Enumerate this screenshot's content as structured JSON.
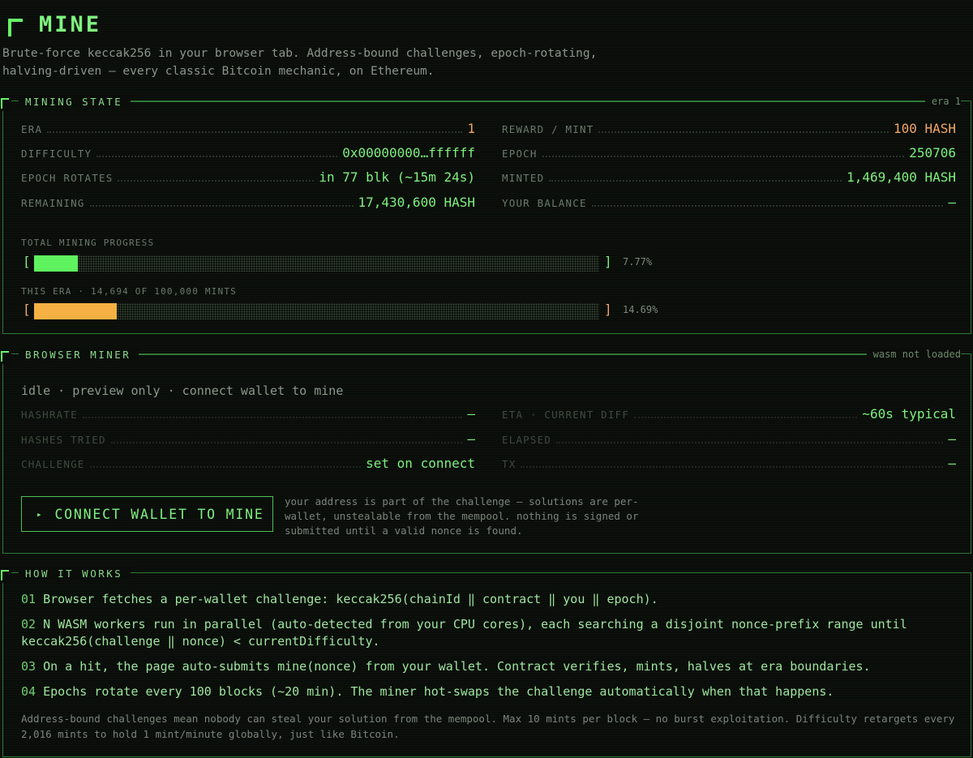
{
  "header": {
    "title": "MINE",
    "subtitle": "Brute-force keccak256 in your browser tab. Address-bound challenges, epoch-rotating, halving-driven — every classic Bitcoin mechanic, on Ethereum."
  },
  "mining_state": {
    "title": "MINING STATE",
    "tag": "era 1",
    "left": [
      {
        "label": "ERA",
        "value": "1"
      },
      {
        "label": "DIFFICULTY",
        "value": "0x00000000…ffffff"
      },
      {
        "label": "EPOCH ROTATES",
        "value": "in 77 blk (~15m 24s)"
      },
      {
        "label": "REMAINING",
        "value": "17,430,600 HASH"
      }
    ],
    "right": [
      {
        "label": "REWARD / MINT",
        "value": "100 HASH"
      },
      {
        "label": "EPOCH",
        "value": "250706"
      },
      {
        "label": "MINTED",
        "value": "1,469,400 HASH"
      },
      {
        "label": "YOUR BALANCE",
        "value": "—"
      }
    ],
    "total_progress": {
      "label": "TOTAL MINING PROGRESS",
      "percent_text": "7.77%",
      "fraction": 0.0777,
      "bracket_open": "[",
      "bracket_close": "]"
    },
    "era_progress": {
      "label": "THIS ERA · 14,694 OF 100,000 MINTS",
      "percent_text": "14.69%",
      "fraction": 0.1469,
      "bracket_open": "[",
      "bracket_close": "]"
    },
    "colors": {
      "accent": "#7ef07e",
      "orange": "#f1a668",
      "total_bar": "#5ef25e",
      "era_bar": "#f4b043"
    }
  },
  "browser_miner": {
    "title": "BROWSER MINER",
    "tag": "wasm not loaded",
    "status": "idle · preview only · connect wallet to mine",
    "left": [
      {
        "label": "HASHRATE",
        "value": "—"
      },
      {
        "label": "HASHES TRIED",
        "value": "—"
      },
      {
        "label": "CHALLENGE",
        "value": "set on connect"
      }
    ],
    "right": [
      {
        "label": "ETA · CURRENT DIFF",
        "value": "~60s typical"
      },
      {
        "label": "ELAPSED",
        "value": "—"
      },
      {
        "label": "TX",
        "value": "—"
      }
    ],
    "connect_label": "CONNECT WALLET TO MINE",
    "connect_icon": "▸",
    "note": "your address is part of the challenge — solutions are per-wallet, unstealable from the mempool. nothing is signed or submitted until a valid nonce is found."
  },
  "how_it_works": {
    "title": "HOW IT WORKS",
    "steps": [
      {
        "num": "01",
        "text": "Browser fetches a per-wallet challenge: keccak256(chainId ‖ contract ‖ you ‖ epoch)."
      },
      {
        "num": "02",
        "text": "N WASM workers run in parallel (auto-detected from your CPU cores), each searching a disjoint nonce-prefix range until keccak256(challenge ‖ nonce) < currentDifficulty."
      },
      {
        "num": "03",
        "text": "On a hit, the page auto-submits mine(nonce) from your wallet. Contract verifies, mints, halves at era boundaries."
      },
      {
        "num": "04",
        "text": "Epochs rotate every 100 blocks (~20 min). The miner hot-swaps the challenge automatically when that happens."
      }
    ],
    "footnote": "Address-bound challenges mean nobody can steal your solution from the mempool. Max 10 mints per block — no burst exploitation. Difficulty retargets every 2,016 mints to hold 1 mint/minute globally, just like Bitcoin."
  }
}
